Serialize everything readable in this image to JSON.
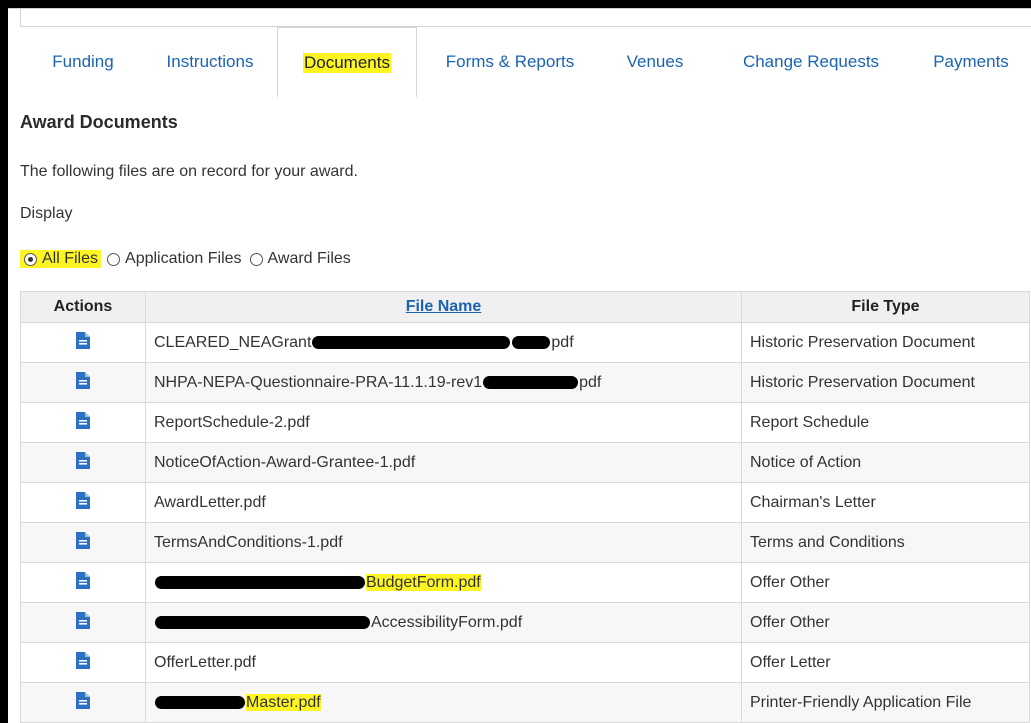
{
  "tabs": [
    {
      "label": "Funding",
      "active": false
    },
    {
      "label": "Instructions",
      "active": false
    },
    {
      "label": "Documents",
      "active": true
    },
    {
      "label": "Forms & Reports",
      "active": false
    },
    {
      "label": "Venues",
      "active": false
    },
    {
      "label": "Change Requests",
      "active": false
    },
    {
      "label": "Payments",
      "active": false
    }
  ],
  "section": {
    "title": "Award Documents",
    "description": "The following files are on record for your award.",
    "display_label": "Display"
  },
  "filters": [
    {
      "label": "All Files",
      "selected": true
    },
    {
      "label": "Application Files",
      "selected": false
    },
    {
      "label": "Award Files",
      "selected": false
    }
  ],
  "table": {
    "headers": {
      "actions": "Actions",
      "file_name": "File Name",
      "file_type": "File Type"
    },
    "rows": [
      {
        "name_prefix": "CLEARED_NEAGrant",
        "name_suffix": "pdf",
        "redacted": true,
        "type": "Historic Preservation Document"
      },
      {
        "name_prefix": "NHPA-NEPA-Questionnaire-PRA-11.1.19-rev1",
        "name_suffix": "pdf",
        "redacted": true,
        "type": "Historic Preservation Document"
      },
      {
        "name_prefix": "ReportSchedule-2.pdf",
        "name_suffix": "",
        "redacted": false,
        "type": "Report Schedule"
      },
      {
        "name_prefix": "NoticeOfAction-Award-Grantee-1.pdf",
        "name_suffix": "",
        "redacted": false,
        "type": "Notice of Action"
      },
      {
        "name_prefix": "AwardLetter.pdf",
        "name_suffix": "",
        "redacted": false,
        "type": "Chairman's Letter"
      },
      {
        "name_prefix": "TermsAndConditions-1.pdf",
        "name_suffix": "",
        "redacted": false,
        "type": "Terms and Conditions"
      },
      {
        "name_prefix": "",
        "name_suffix": "BudgetForm.pdf",
        "redacted": true,
        "highlight": true,
        "type": "Offer Other"
      },
      {
        "name_prefix": "",
        "name_suffix": "AccessibilityForm.pdf",
        "redacted": true,
        "type": "Offer Other"
      },
      {
        "name_prefix": "OfferLetter.pdf",
        "name_suffix": "",
        "redacted": false,
        "type": "Offer Letter"
      },
      {
        "name_prefix": "",
        "name_suffix": "Master.pdf",
        "redacted": true,
        "highlight": true,
        "type": "Printer-Friendly Application File"
      }
    ]
  },
  "icons": {
    "document": "document-icon"
  },
  "colors": {
    "link": "#1b64b4",
    "highlight": "#fdf523",
    "icon": "#2d6fc0"
  }
}
